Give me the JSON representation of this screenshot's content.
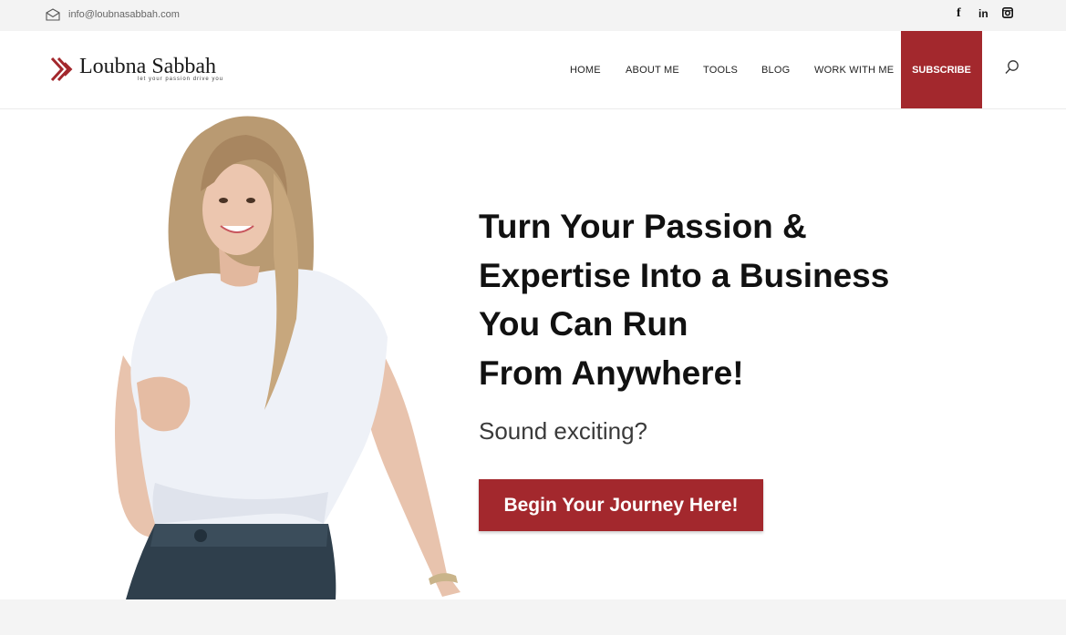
{
  "topbar": {
    "email": "info@loubnasabbah.com",
    "social": [
      {
        "icon": "facebook-icon",
        "glyph": "f"
      },
      {
        "icon": "linkedin-icon",
        "glyph": "in"
      },
      {
        "icon": "instagram-icon"
      }
    ]
  },
  "header": {
    "logo_name": "Loubna Sabbah",
    "logo_tagline": "let your passion drive you",
    "nav": [
      "HOME",
      "ABOUT ME",
      "TOOLS",
      "BLOG",
      "WORK WITH ME"
    ],
    "subscribe_label": "SUBSCRIBE"
  },
  "hero": {
    "headline_lines": [
      "Turn Your Passion &",
      "Expertise Into a Business",
      "You Can Run",
      "From Anywhere!"
    ],
    "subhead": "Sound exciting?",
    "cta_label": "Begin Your Journey Here!"
  },
  "colors": {
    "brand": "#a3282d",
    "text": "#111111",
    "topbar_bg": "#f3f3f3"
  }
}
